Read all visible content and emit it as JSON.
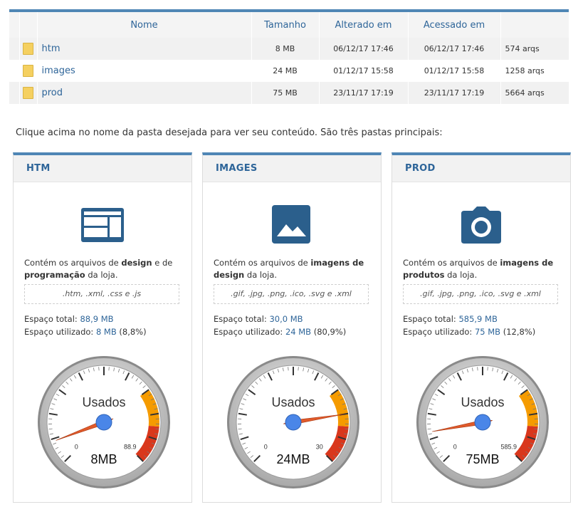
{
  "table": {
    "headers": [
      "Nome",
      "Tamanho",
      "Alterado em",
      "Acessado em"
    ],
    "rows": [
      {
        "name": "htm",
        "size": "8 MB",
        "modified": "06/12/17 17:46",
        "accessed": "06/12/17 17:46",
        "count": "574 arqs"
      },
      {
        "name": "images",
        "size": "24 MB",
        "modified": "01/12/17 15:58",
        "accessed": "01/12/17 15:58",
        "count": "1258 arqs"
      },
      {
        "name": "prod",
        "size": "75 MB",
        "modified": "23/11/17 17:19",
        "accessed": "23/11/17 17:19",
        "count": "5664 arqs"
      }
    ]
  },
  "caption": "Clique acima no nome da pasta desejada para ver seu conteúdo. São três pastas principais:",
  "cards": [
    {
      "title": "HTM",
      "icon": "layout-icon",
      "desc_pre": "Contém os arquivos de ",
      "desc_bold1": "design",
      "desc_mid": " e de ",
      "desc_bold2": "programação",
      "desc_post": " da loja.",
      "extensions": ".htm, .xml, .css e .js",
      "total_label": "Espaço total: ",
      "total_value": "88,9 MB",
      "used_label": "Espaço utilizado: ",
      "used_value": "8 MB",
      "used_pct": "(8,8%)",
      "gauge": {
        "label": "Usados",
        "min": 0,
        "max": 88.9,
        "max_label": "88.9",
        "value": 8,
        "value_label": "8MB"
      }
    },
    {
      "title": "IMAGES",
      "icon": "image-icon",
      "desc_pre": "Contém os arquivos de ",
      "desc_bold1": "imagens de design",
      "desc_mid": "",
      "desc_bold2": "",
      "desc_post": " da loja.",
      "extensions": ".gif, .jpg, .png, .ico, .svg e .xml",
      "total_label": "Espaço total: ",
      "total_value": "30,0 MB",
      "used_label": "Espaço utilizado: ",
      "used_value": "24 MB",
      "used_pct": "(80,9%)",
      "gauge": {
        "label": "Usados",
        "min": 0,
        "max": 30,
        "max_label": "30",
        "value": 24,
        "value_label": "24MB"
      }
    },
    {
      "title": "PROD",
      "icon": "camera-icon",
      "desc_pre": "Contém os arquivos de ",
      "desc_bold1": "imagens de produtos",
      "desc_mid": "",
      "desc_bold2": "",
      "desc_post": " da loja.",
      "extensions": ".gif, .jpg, .png, .ico, .svg e .xml",
      "total_label": "Espaço total: ",
      "total_value": "585,9 MB",
      "used_label": "Espaço utilizado: ",
      "used_value": "75 MB",
      "used_pct": "(12,8%)",
      "gauge": {
        "label": "Usados",
        "min": 0,
        "max": 585.9,
        "max_label": "585.9",
        "value": 75,
        "value_label": "75MB"
      }
    }
  ],
  "colors": {
    "accent": "#4f86b5",
    "link": "#2e6599",
    "icon": "#2b5f8c",
    "gauge_orange": "#f59b00",
    "gauge_red": "#d9371c",
    "needle": "#e05a2b",
    "hub": "#4a86e8"
  }
}
